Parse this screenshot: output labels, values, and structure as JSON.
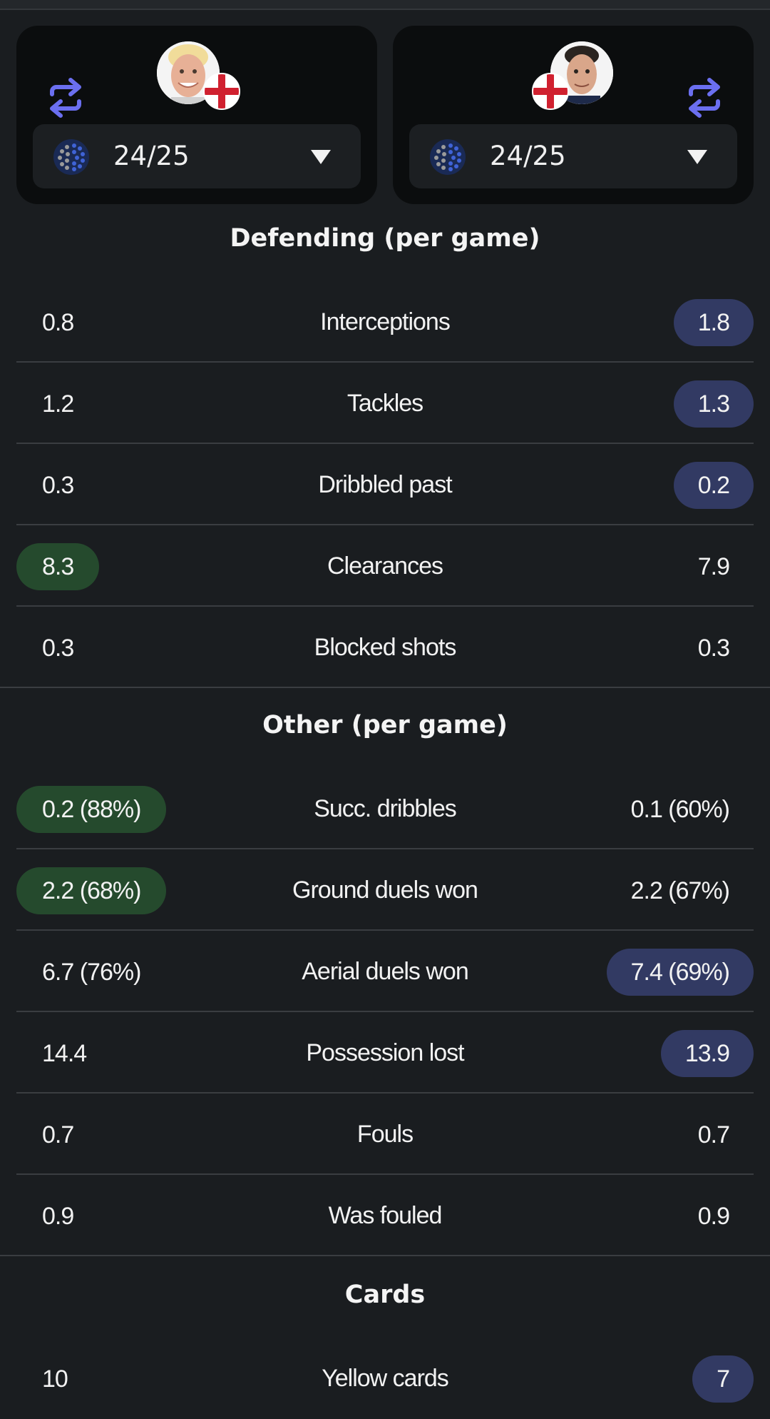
{
  "players": {
    "left": {
      "season": "24/25"
    },
    "right": {
      "season": "24/25"
    }
  },
  "colors": {
    "accent": "#6b6ff0",
    "highlight_left": "#254a2d",
    "highlight_right": "#323a63",
    "card_bg": "#0b0d0e",
    "page_bg": "#1a1d20"
  },
  "sections": {
    "defending": {
      "title": "Defending (per game)",
      "rows": [
        {
          "label": "Interceptions",
          "left": "0.8",
          "right": "1.8"
        },
        {
          "label": "Tackles",
          "left": "1.2",
          "right": "1.3"
        },
        {
          "label": "Dribbled past",
          "left": "0.3",
          "right": "0.2"
        },
        {
          "label": "Clearances",
          "left": "8.3",
          "right": "7.9"
        },
        {
          "label": "Blocked shots",
          "left": "0.3",
          "right": "0.3"
        }
      ]
    },
    "other": {
      "title": "Other (per game)",
      "rows": [
        {
          "label": "Succ. dribbles",
          "left": "0.2 (88%)",
          "right": "0.1 (60%)"
        },
        {
          "label": "Ground duels won",
          "left": "2.2 (68%)",
          "right": "2.2 (67%)"
        },
        {
          "label": "Aerial duels won",
          "left": "6.7 (76%)",
          "right": "7.4 (69%)"
        },
        {
          "label": "Possession lost",
          "left": "14.4",
          "right": "13.9"
        },
        {
          "label": "Fouls",
          "left": "0.7",
          "right": "0.7"
        },
        {
          "label": "Was fouled",
          "left": "0.9",
          "right": "0.9"
        }
      ]
    },
    "cards": {
      "title": "Cards",
      "rows": [
        {
          "label": "Yellow cards",
          "left": "10",
          "right": "7"
        }
      ]
    }
  }
}
